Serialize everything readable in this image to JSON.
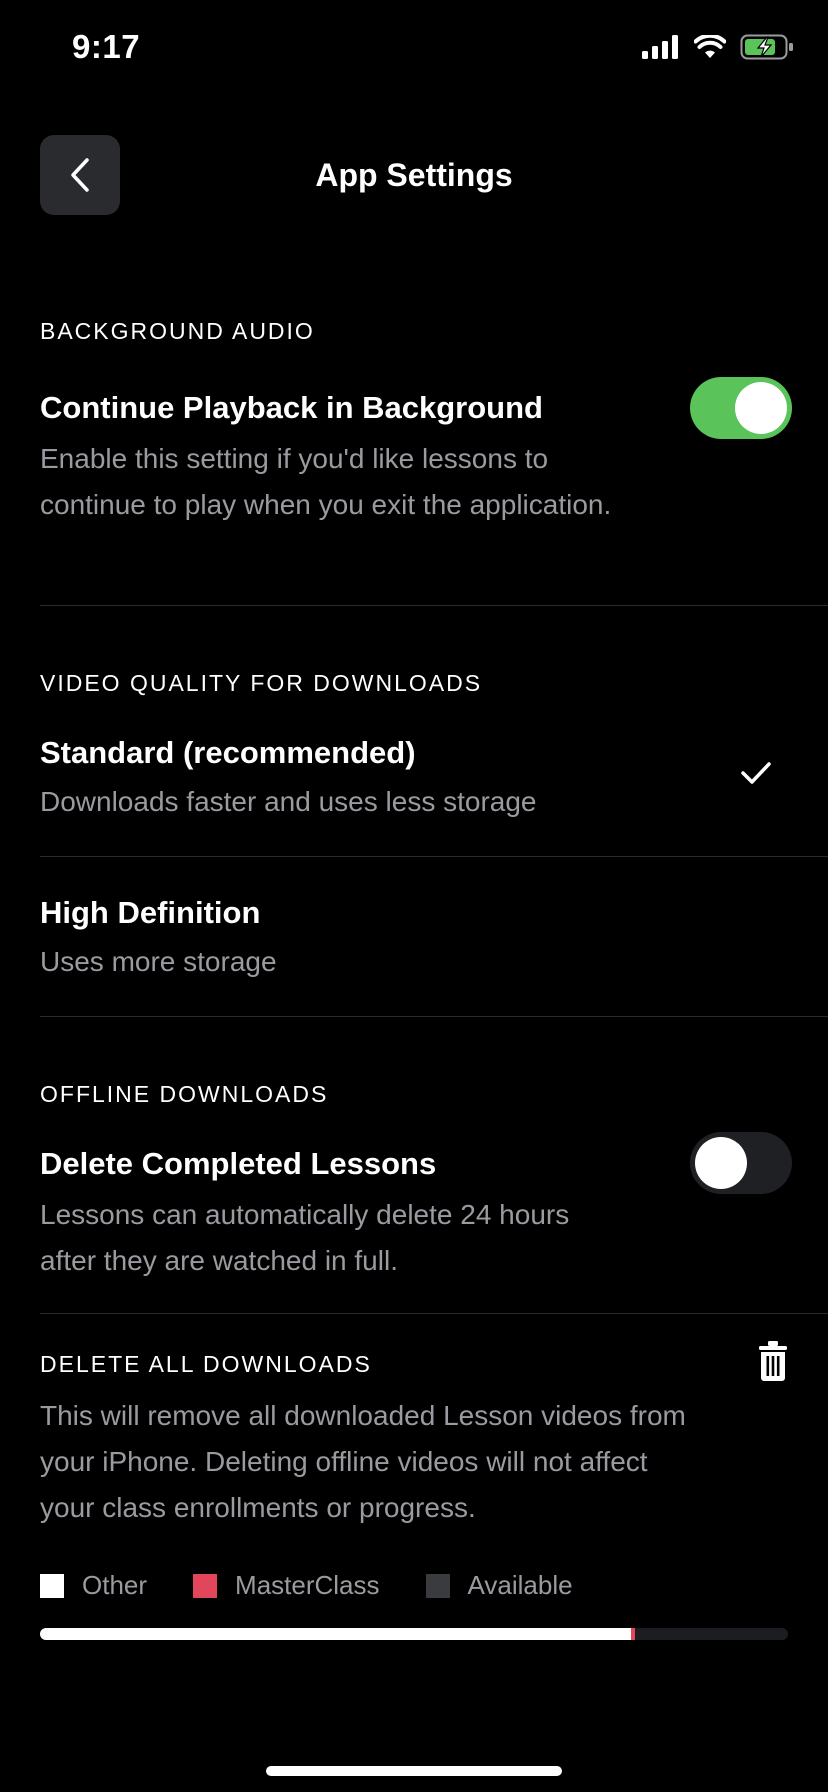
{
  "status": {
    "time": "9:17"
  },
  "header": {
    "title": "App Settings"
  },
  "background_audio": {
    "section_label": "BACKGROUND AUDIO",
    "title": "Continue Playback in Background",
    "description": "Enable this setting if you'd like lessons to continue to play when you exit the application.",
    "toggle_on": true
  },
  "video_quality": {
    "section_label": "VIDEO QUALITY FOR DOWNLOADS",
    "options": [
      {
        "title": "Standard (recommended)",
        "description": "Downloads faster and uses less storage",
        "selected": true
      },
      {
        "title": "High Definition",
        "description": "Uses more storage",
        "selected": false
      }
    ]
  },
  "offline_downloads": {
    "section_label": "OFFLINE DOWNLOADS",
    "title": "Delete Completed Lessons",
    "description": "Lessons can automatically delete 24 hours after they are watched in full.",
    "toggle_on": false
  },
  "delete_all": {
    "section_label": "DELETE ALL DOWNLOADS",
    "description": "This will remove all downloaded Lesson videos from your iPhone. Deleting offline videos will not affect your class enrollments or progress."
  },
  "storage": {
    "legend": [
      {
        "label": "Other",
        "color": "#ffffff"
      },
      {
        "label": "MasterClass",
        "color": "#e2465a"
      },
      {
        "label": "Available",
        "color": "#3a3b3e"
      }
    ],
    "fractions": {
      "other": 0.79,
      "masterclass": 0.005,
      "available": 0.205
    }
  },
  "colors": {
    "toggle_on": "#5ac35a",
    "toggle_off": "#1f2023",
    "muted_text": "#9a9ba0"
  }
}
